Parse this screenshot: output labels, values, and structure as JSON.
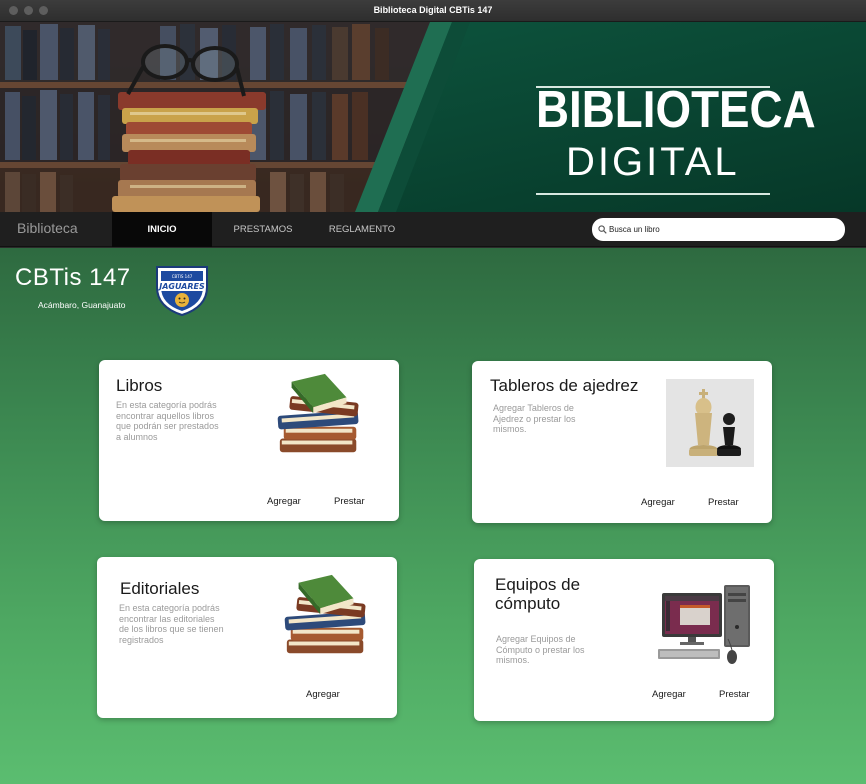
{
  "window": {
    "title": "Biblioteca Digital CBTis 147"
  },
  "banner": {
    "title_line1": "BIBLIOTECA",
    "title_line2": "DIGITAL"
  },
  "nav": {
    "brand": "Biblioteca",
    "items": [
      {
        "label": "INICIO",
        "active": true
      },
      {
        "label": "PRESTAMOS",
        "active": false
      },
      {
        "label": "REGLAMENTO",
        "active": false
      }
    ],
    "search": {
      "placeholder": "Busca un libro",
      "value": ""
    }
  },
  "school": {
    "name": "CBTis 147",
    "city": "Acámbaro, Guanajuato",
    "logo": "jaguares-shield-logo"
  },
  "cards": [
    {
      "title": "Libros",
      "description": "En esta categoría podrás encontrar aquellos libros que podrán ser prestados a alumnos",
      "image": "books-stack-icon",
      "actions": [
        "Agregar",
        "Prestar"
      ]
    },
    {
      "title": "Tableros de ajedrez",
      "description": "Agregar Tableros de Ajedrez o prestar los mismos.",
      "image": "chess-pieces-icon",
      "actions": [
        "Agregar",
        "Prestar"
      ]
    },
    {
      "title": "Editoriales",
      "description": "En esta categoría podrás encontrar las editoriales de los libros que se tienen registrados",
      "image": "books-stack-icon",
      "actions": [
        "Agregar"
      ]
    },
    {
      "title": "Equipos de cómputo",
      "description": "Agregar Equipos de Cómputo o prestar los mismos.",
      "image": "desktop-computer-icon",
      "actions": [
        "Agregar",
        "Prestar"
      ]
    }
  ],
  "colors": {
    "nav_bg": "#1f1f1f",
    "nav_active_bg": "#080808",
    "banner_green": "#0b4634",
    "content_green_top": "#2e6a40",
    "content_green_bottom": "#5bbd70"
  }
}
